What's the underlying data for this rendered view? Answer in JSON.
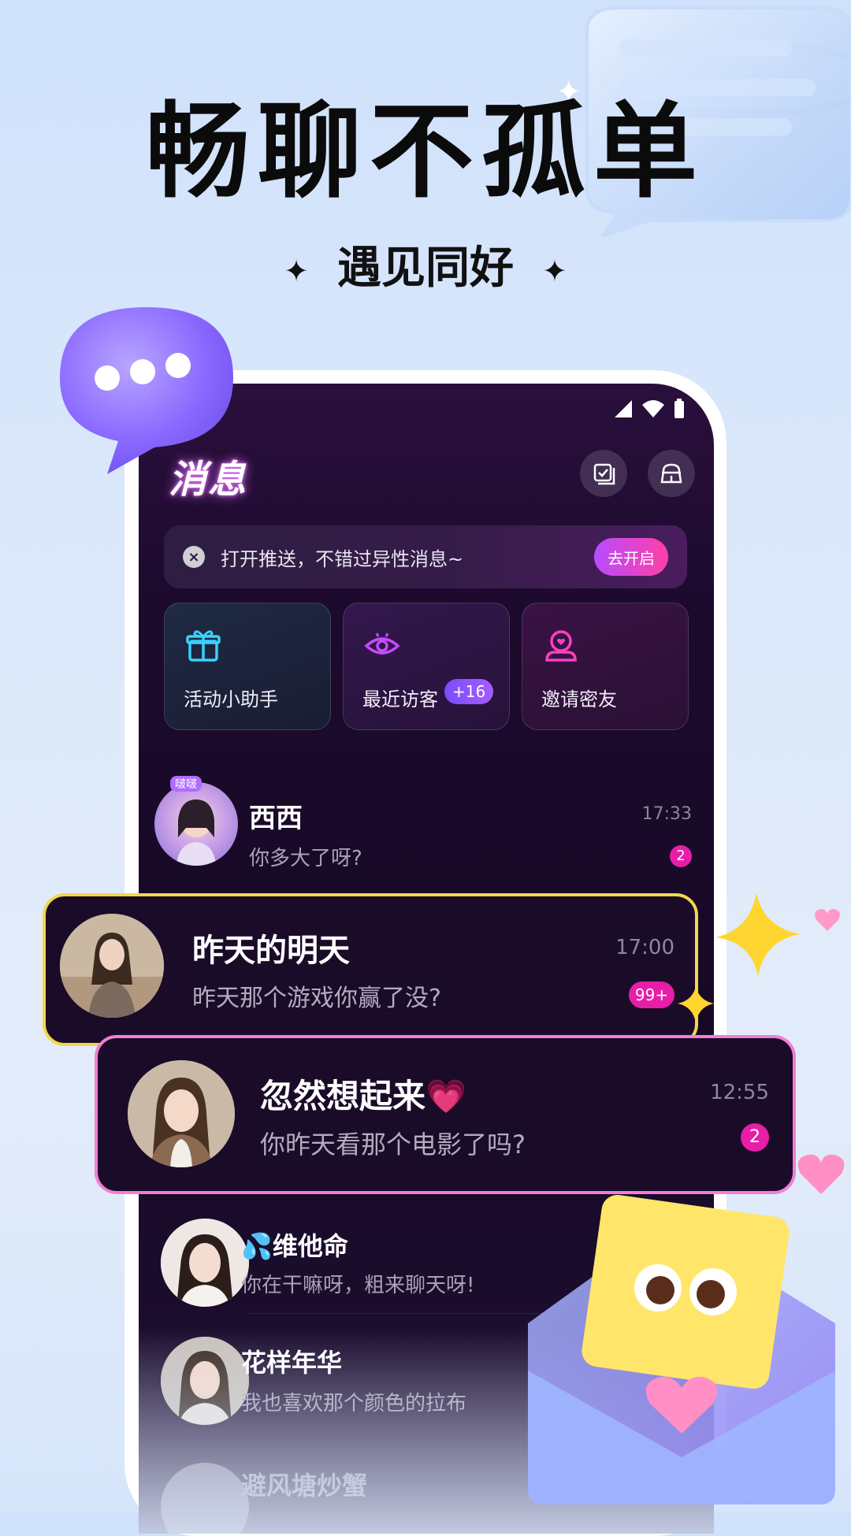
{
  "headline": "畅聊不孤单",
  "subheadline": "遇见同好",
  "star_glyph": "✦",
  "title": "消息",
  "push": {
    "text": "打开推送，不错过异性消息~",
    "button": "去开启"
  },
  "cards": [
    {
      "label": "活动小助手",
      "icon": "gift-icon"
    },
    {
      "label": "最近访客",
      "badge": "+16",
      "icon": "eye-icon"
    },
    {
      "label": "邀请密友",
      "icon": "profile-heart-icon"
    }
  ],
  "conversations": [
    {
      "name": "西西",
      "message": "你多大了呀?",
      "time": "17:33",
      "unread": "2",
      "avatar_tag": "啵啵"
    },
    {
      "name": "昨天的明天",
      "message": "昨天那个游戏你赢了没?",
      "time": "17:00",
      "unread": "99+"
    },
    {
      "name": "忽然想起来💗",
      "message": "你昨天看那个电影了吗?",
      "time": "12:55",
      "unread": "2"
    },
    {
      "name": "💦维他命",
      "message": "你在干嘛呀，粗来聊天呀!"
    },
    {
      "name": "花样年华",
      "message": "我也喜欢那个颜色的拉布"
    },
    {
      "name": "避风塘炒蟹"
    }
  ],
  "colors": {
    "accent_pink": "#e61ea8",
    "card_gold_border": "#f3d64e",
    "card_pink_border": "#f07fd3"
  }
}
